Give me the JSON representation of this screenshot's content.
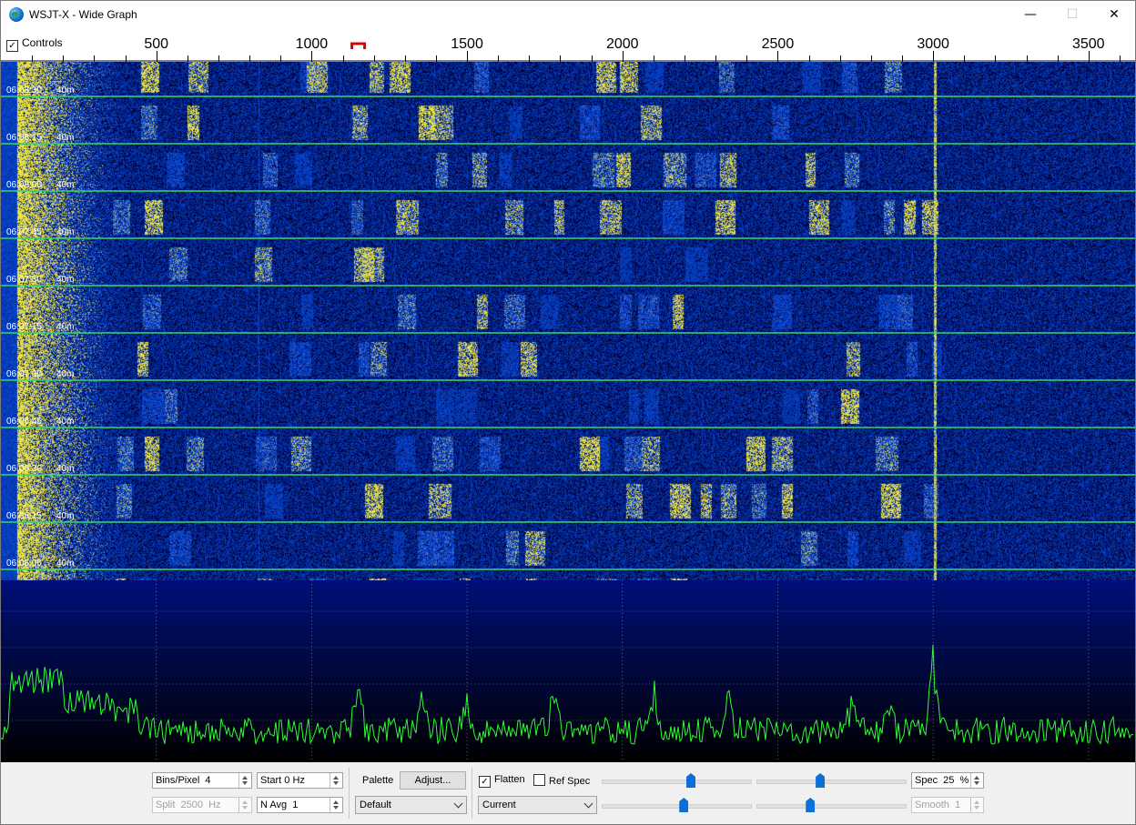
{
  "window": {
    "title": "WSJT-X - Wide Graph",
    "minimize": "—",
    "maximize": "☐",
    "close": "✕"
  },
  "scale": {
    "controls_label": "Controls",
    "controls_checked": true,
    "tick_labels": [
      "500",
      "1000",
      "1500",
      "2000",
      "2500",
      "3000",
      "3500"
    ],
    "tick_values": [
      500,
      1000,
      1500,
      2000,
      2500,
      3000,
      3500
    ],
    "freq_min": 0,
    "freq_max": 3650,
    "rx_marker_hz": 1150,
    "tx_marker_hz": 3000,
    "marker_color": "#e00000"
  },
  "waterfall": {
    "time_labels": [
      "06:08:30",
      "06:08:15",
      "06:08:00",
      "06:07:45",
      "06:07:30",
      "06:07:15",
      "06:07:00",
      "06:06:45",
      "06:06:30",
      "06:06:15",
      "06:06:00"
    ],
    "band_label": "40m",
    "line_color": "#34d86a",
    "colors": {
      "bg": "#0a1e8c",
      "signal": "#f3e040"
    }
  },
  "spectrum": {
    "line_color": "#2dff2d",
    "bg_top": "#000f78",
    "bg_bottom": "#000000"
  },
  "controls": {
    "bins_per_pixel": "Bins/Pixel  4",
    "start": "Start 0 Hz",
    "split": "Split  2500  Hz",
    "navg": "N Avg  1",
    "palette_label": "Palette",
    "adjust_button": "Adjust...",
    "palette_value": "Default",
    "flatten_label": "Flatten",
    "flatten_checked": true,
    "refspec_label": "Ref Spec",
    "refspec_checked": false,
    "spectrum_type": "Current",
    "spec_percent": "Spec  25  %",
    "smooth": "Smooth  1",
    "sliders": {
      "wf_gain": 0.6,
      "wf_zero": 0.42,
      "spec_gain": 0.55,
      "spec_zero": 0.35
    }
  }
}
